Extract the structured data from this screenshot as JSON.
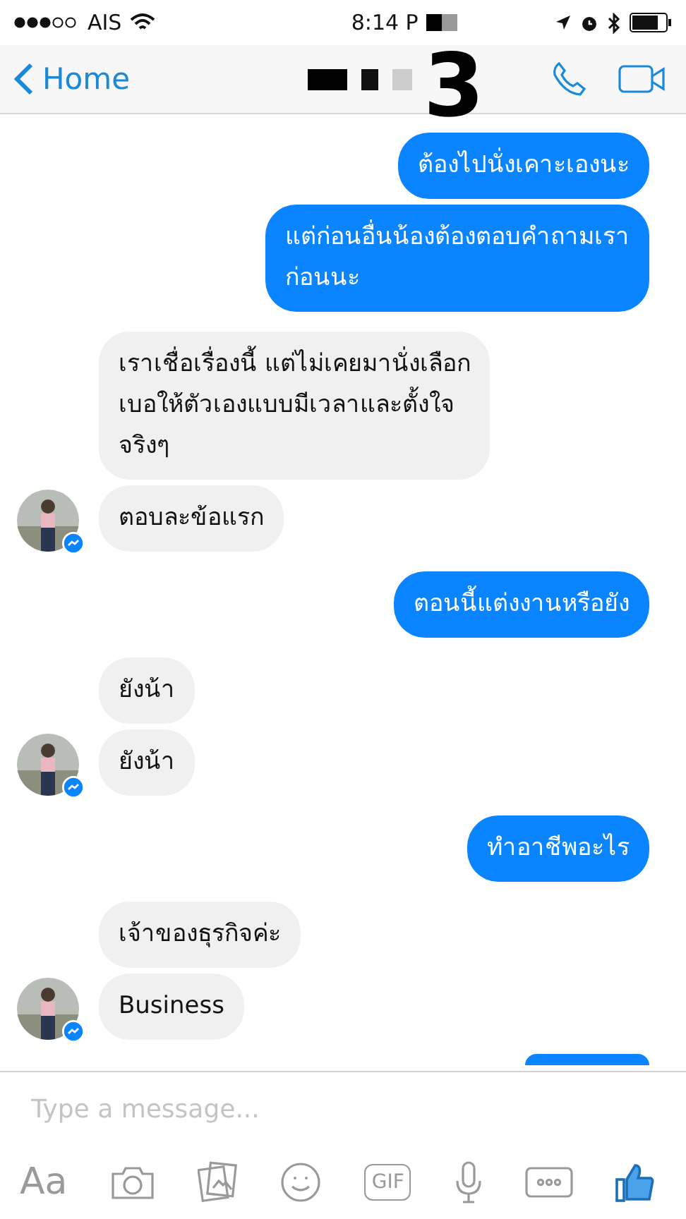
{
  "status_bar": {
    "carrier": "AIS",
    "time": "8:14 P"
  },
  "nav": {
    "back": "Home",
    "overlay_mark": "3"
  },
  "messages": [
    {
      "kind": "sent",
      "lines": [
        "ต้องไปนั่งเคาะเองนะ"
      ]
    },
    {
      "kind": "sent",
      "lines": [
        "แต่ก่อนอื่นน้องต้องตอบคำถามเรา",
        "ก่อนนะ"
      ]
    },
    {
      "kind": "received",
      "lines": [
        "เราเชื่อเรื่องนี้ แต่ไม่เคยมานั่งเลือก",
        "เบอให้ตัวเองแบบมีเวลาและตั้งใจ",
        "จริงๆ"
      ],
      "avatar": false
    },
    {
      "kind": "received",
      "lines": [
        "ตอบละข้อแรก"
      ],
      "avatar": true
    },
    {
      "kind": "sent",
      "lines": [
        "ตอนนี้แต่งงานหรือยัง"
      ]
    },
    {
      "kind": "received",
      "lines": [
        "ยังน้า"
      ],
      "avatar": false
    },
    {
      "kind": "received",
      "lines": [
        "ยังน้า"
      ],
      "avatar": true
    },
    {
      "kind": "sent",
      "lines": [
        "ทำอาชีพอะไร"
      ]
    },
    {
      "kind": "received",
      "lines": [
        "เจ้าของธุรกิจค่ะ"
      ],
      "avatar": false
    },
    {
      "kind": "received",
      "lines": [
        "Business"
      ],
      "avatar": true
    },
    {
      "kind": "sent_partial"
    }
  ],
  "composer": {
    "placeholder": "Type a message...",
    "text_button": "Aa",
    "gif_button": "GIF"
  }
}
